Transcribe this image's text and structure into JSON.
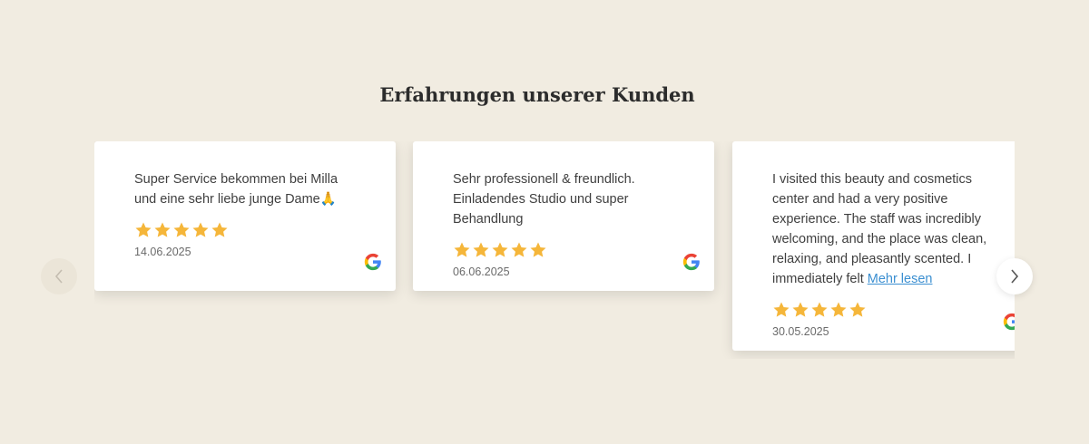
{
  "section": {
    "title": "Erfahrungen unserer Kunden"
  },
  "reviews": [
    {
      "text": "Super Service bekommen bei Milla und eine sehr liebe junge Dame🙏",
      "rating": 5,
      "date": "14.06.2025",
      "source_icon": "google-icon"
    },
    {
      "text": "Sehr professionell & freundlich. Einladendes Studio und super Behandlung",
      "rating": 5,
      "date": "06.06.2025",
      "source_icon": "google-icon"
    },
    {
      "text": "I visited this beauty and cosmetics center and had a very positive experience. The staff was incredibly welcoming, and the place was clean, relaxing, and pleasantly scented. I immediately felt",
      "read_more": "Mehr lesen",
      "rating": 5,
      "date": "30.05.2025",
      "source_icon": "google-icon"
    }
  ],
  "navigation": {
    "prev_icon": "chevron-left-icon",
    "next_icon": "chevron-right-icon"
  },
  "colors": {
    "background": "#f1ece1",
    "star": "#f5b63a",
    "link": "#3b8fd1"
  }
}
